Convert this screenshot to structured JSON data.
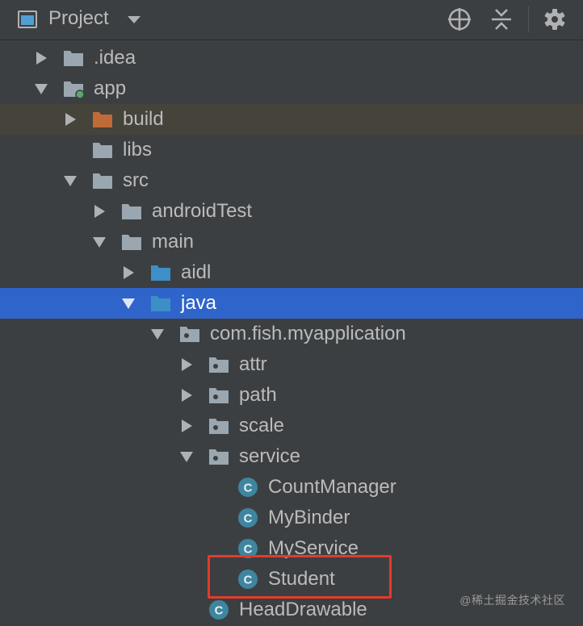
{
  "panel": {
    "title": "Project",
    "view_icon": "project-view-icon",
    "dropdown_icon": "chevron-down-icon",
    "tools": [
      {
        "name": "locate-icon"
      },
      {
        "name": "collapse-all-icon"
      },
      {
        "name": "gear-icon"
      }
    ]
  },
  "tree": [
    {
      "label": ".idea",
      "depth": 0,
      "arrow": "collapsed",
      "icon": "folder"
    },
    {
      "label": "app",
      "depth": 0,
      "arrow": "expanded",
      "icon": "module-folder"
    },
    {
      "label": "build",
      "depth": 1,
      "arrow": "collapsed",
      "icon": "excluded-folder",
      "excluded": true
    },
    {
      "label": "libs",
      "depth": 1,
      "arrow": "none",
      "icon": "folder"
    },
    {
      "label": "src",
      "depth": 1,
      "arrow": "expanded",
      "icon": "folder"
    },
    {
      "label": "androidTest",
      "depth": 2,
      "arrow": "collapsed",
      "icon": "folder"
    },
    {
      "label": "main",
      "depth": 2,
      "arrow": "expanded",
      "icon": "folder"
    },
    {
      "label": "aidl",
      "depth": 3,
      "arrow": "collapsed",
      "icon": "source-folder"
    },
    {
      "label": "java",
      "depth": 3,
      "arrow": "expanded",
      "icon": "source-folder",
      "selected": true
    },
    {
      "label": "com.fish.myapplication",
      "depth": 4,
      "arrow": "expanded",
      "icon": "package"
    },
    {
      "label": "attr",
      "depth": 5,
      "arrow": "collapsed",
      "icon": "package"
    },
    {
      "label": "path",
      "depth": 5,
      "arrow": "collapsed",
      "icon": "package"
    },
    {
      "label": "scale",
      "depth": 5,
      "arrow": "collapsed",
      "icon": "package"
    },
    {
      "label": "service",
      "depth": 5,
      "arrow": "expanded",
      "icon": "package"
    },
    {
      "label": "CountManager",
      "depth": 6,
      "arrow": "none",
      "icon": "class"
    },
    {
      "label": "MyBinder",
      "depth": 6,
      "arrow": "none",
      "icon": "class"
    },
    {
      "label": "MyService",
      "depth": 6,
      "arrow": "none",
      "icon": "class"
    },
    {
      "label": "Student",
      "depth": 6,
      "arrow": "none",
      "icon": "class",
      "highlighted": true
    },
    {
      "label": "HeadDrawable",
      "depth": 5,
      "arrow": "none",
      "icon": "class"
    }
  ],
  "colors": {
    "background": "#3c3f41",
    "selection": "#2f65ca",
    "excluded_row": "#45433a",
    "folder": "#9aa7b0",
    "source_folder": "#3d8fc7",
    "excluded_folder": "#c06b37",
    "class_icon": "#3e86a0",
    "highlight_box": "#e53a2a"
  },
  "watermark": "@稀土掘金技术社区"
}
